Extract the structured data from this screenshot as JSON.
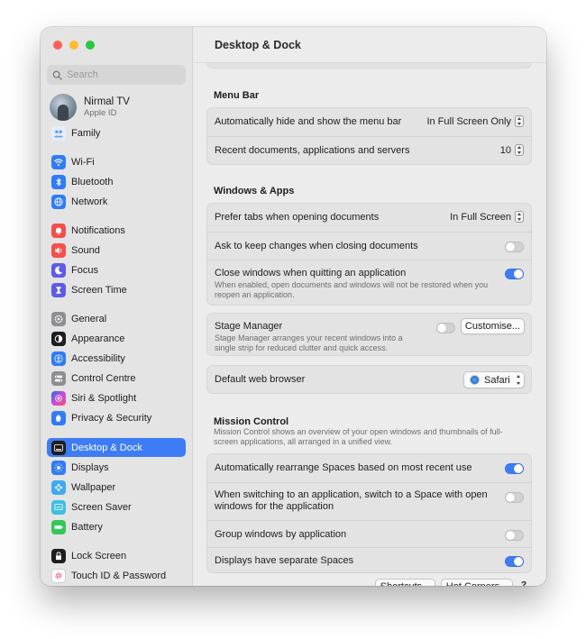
{
  "window": {
    "title": "Desktop & Dock"
  },
  "search": {
    "placeholder": "Search"
  },
  "account": {
    "name": "Nirmal TV",
    "subtitle": "Apple ID"
  },
  "sidebar": {
    "items": [
      {
        "label": "Family",
        "icon": "family-icon",
        "color": "#5aa2f5"
      },
      {
        "label": "Wi-Fi",
        "icon": "wifi-icon",
        "color": "#2f7cf6"
      },
      {
        "label": "Bluetooth",
        "icon": "bluetooth-icon",
        "color": "#2f7cf6"
      },
      {
        "label": "Network",
        "icon": "network-icon",
        "color": "#2f7cf6"
      },
      {
        "label": "Notifications",
        "icon": "notifications-icon",
        "color": "#f2504b"
      },
      {
        "label": "Sound",
        "icon": "sound-icon",
        "color": "#f2504b"
      },
      {
        "label": "Focus",
        "icon": "focus-icon",
        "color": "#5e5ce6"
      },
      {
        "label": "Screen Time",
        "icon": "screen-time-icon",
        "color": "#5e5ce6"
      },
      {
        "label": "General",
        "icon": "gear-icon",
        "color": "#8e8e93"
      },
      {
        "label": "Appearance",
        "icon": "appearance-icon",
        "color": "#1d1d1f"
      },
      {
        "label": "Accessibility",
        "icon": "accessibility-icon",
        "color": "#2f7cf6"
      },
      {
        "label": "Control Centre",
        "icon": "control-centre-icon",
        "color": "#8e8e93"
      },
      {
        "label": "Siri & Spotlight",
        "icon": "siri-icon",
        "color": "#b04ee0"
      },
      {
        "label": "Privacy & Security",
        "icon": "privacy-hand-icon",
        "color": "#2f7cf6"
      },
      {
        "label": "Desktop & Dock",
        "icon": "desktop-dock-icon",
        "color": "#1d1d1f"
      },
      {
        "label": "Displays",
        "icon": "displays-icon",
        "color": "#2f7cf6"
      },
      {
        "label": "Wallpaper",
        "icon": "wallpaper-icon",
        "color": "#3fa9f5"
      },
      {
        "label": "Screen Saver",
        "icon": "screen-saver-icon",
        "color": "#3fbfe0"
      },
      {
        "label": "Battery",
        "icon": "battery-icon",
        "color": "#34c759"
      },
      {
        "label": "Lock Screen",
        "icon": "lock-icon",
        "color": "#1d1d1f"
      },
      {
        "label": "Touch ID & Password",
        "icon": "fingerprint-icon",
        "color": "#ffffff"
      }
    ]
  },
  "menu_bar": {
    "title": "Menu Bar",
    "auto_hide_label": "Automatically hide and show the menu bar",
    "auto_hide_value": "In Full Screen Only",
    "recent_label": "Recent documents, applications and servers",
    "recent_value": "10"
  },
  "windows_apps": {
    "title": "Windows & Apps",
    "prefer_tabs_label": "Prefer tabs when opening documents",
    "prefer_tabs_value": "In Full Screen",
    "ask_keep_label": "Ask to keep changes when closing documents",
    "ask_keep_on": false,
    "close_windows_label": "Close windows when quitting an application",
    "close_windows_desc_1": "When enabled, open documents and windows will not be restored when you",
    "close_windows_desc_2": "reopen an application.",
    "close_windows_on": true
  },
  "stage_manager": {
    "label": "Stage Manager",
    "desc_1": "Stage Manager arranges your recent windows into a",
    "desc_2": "single strip for reduced clutter and quick access.",
    "on": false,
    "customise_label": "Customise..."
  },
  "browser": {
    "label": "Default web browser",
    "value": "Safari"
  },
  "mission_control": {
    "title": "Mission Control",
    "desc_1": "Mission Control shows an overview of your open windows and thumbnails of full-",
    "desc_2": "screen applications, all arranged in a unified view.",
    "rearrange_label": "Automatically rearrange Spaces based on most recent use",
    "rearrange_on": true,
    "switch_label_1": "When switching to an application, switch to a Space with open",
    "switch_label_2": "windows for the application",
    "switch_on": false,
    "group_label": "Group windows by application",
    "group_on": false,
    "separate_label": "Displays have separate Spaces",
    "separate_on": true
  },
  "footer": {
    "shortcuts_label": "Shortcuts...",
    "hot_corners_label": "Hot Corners...",
    "help_label": "?"
  }
}
